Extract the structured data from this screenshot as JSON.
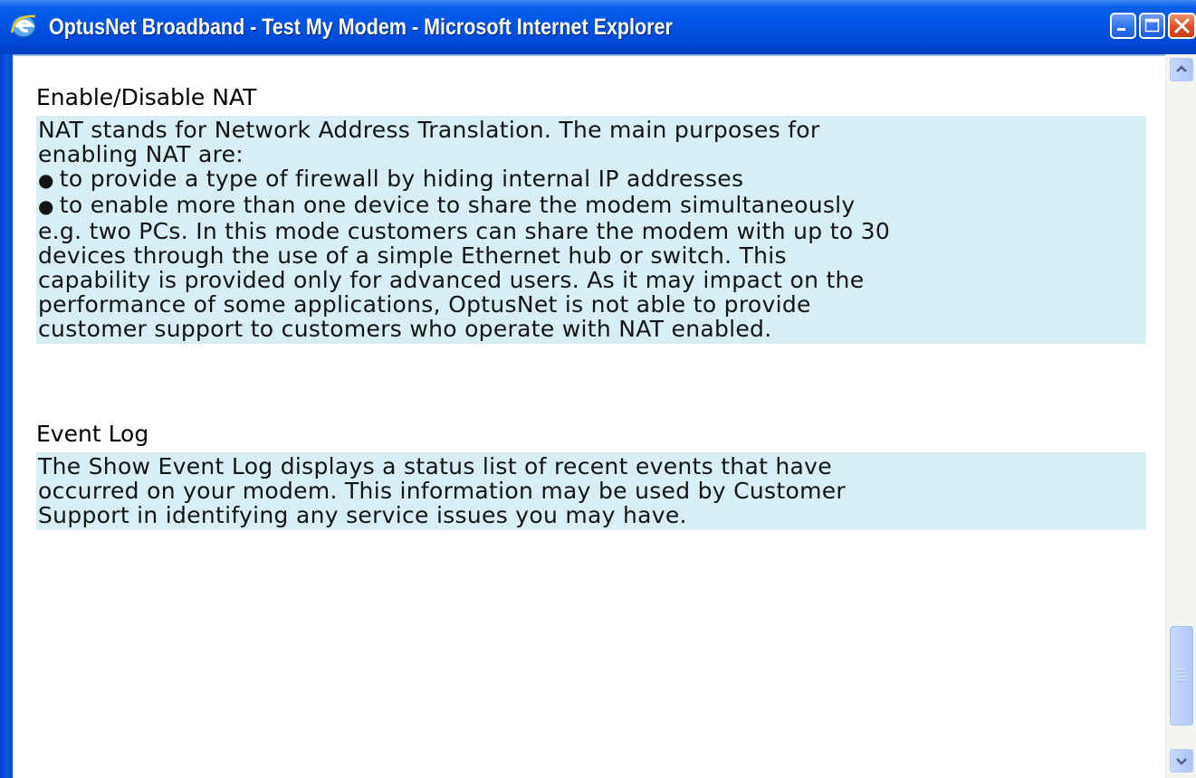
{
  "window": {
    "title": "OptusNet Broadband - Test My Modem - Microsoft Internet Explorer"
  },
  "sections": [
    {
      "heading": "Enable/Disable NAT",
      "lines": [
        "NAT stands for Network Address Translation. The main purposes for",
        "enabling NAT are:"
      ],
      "bullets": [
        "to provide a type of firewall by hiding internal IP addresses",
        "to enable more than one device to share the modem simultaneously"
      ],
      "after_lines": [
        "e.g. two PCs. In this mode customers can share the modem with up to 30",
        "devices through the use of a simple Ethernet hub or switch. This",
        "capability is provided only for advanced users. As it may impact on the",
        "performance of some applications, OptusNet is not able to provide",
        "customer support to customers who operate with NAT enabled."
      ]
    },
    {
      "heading": "Event Log",
      "lines": [
        "The Show Event Log displays a status list of recent events that have",
        "occurred on your modem. This information may be used by Customer",
        "Support in identifying any service issues you may have."
      ]
    }
  ],
  "colors": {
    "titlebar": "#0055e5",
    "highlight": "#d6eef4",
    "close_button": "#e0502a"
  },
  "icons": {
    "app": "ie-icon",
    "minimize": "minimize-icon",
    "maximize": "maximize-icon",
    "close": "close-icon",
    "scroll_up": "chevron-up-icon",
    "scroll_down": "chevron-down-icon"
  }
}
